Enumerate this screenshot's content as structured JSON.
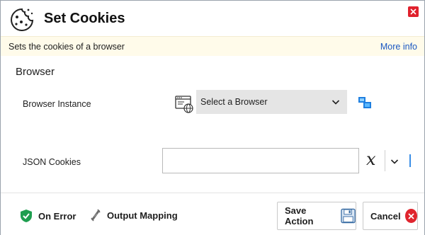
{
  "header": {
    "title": "Set Cookies",
    "logo_icon": "cookie-icon",
    "close_icon": "close-icon",
    "close_color": "#e0212d"
  },
  "info": {
    "description": "Sets the cookies of a browser",
    "more_info": "More info"
  },
  "section": {
    "title": "Browser"
  },
  "fields": {
    "browser_instance": {
      "label": "Browser Instance",
      "value": "Select a Browser",
      "icon": "browser-window-icon",
      "picker_icon": "browser-picker-icon"
    },
    "json_cookies": {
      "label": "JSON Cookies",
      "value": "",
      "variable_icon": "variable-x-icon"
    }
  },
  "footer": {
    "on_error": "On Error",
    "output_mapping": "Output Mapping",
    "save_action": "Save Action",
    "cancel": "Cancel"
  },
  "colors": {
    "info_bar_bg": "#fffbea",
    "link": "#1a57c2",
    "shield": "#1e9e4f",
    "cancel_red": "#e0252e",
    "select_bg": "#e5e5e5"
  }
}
